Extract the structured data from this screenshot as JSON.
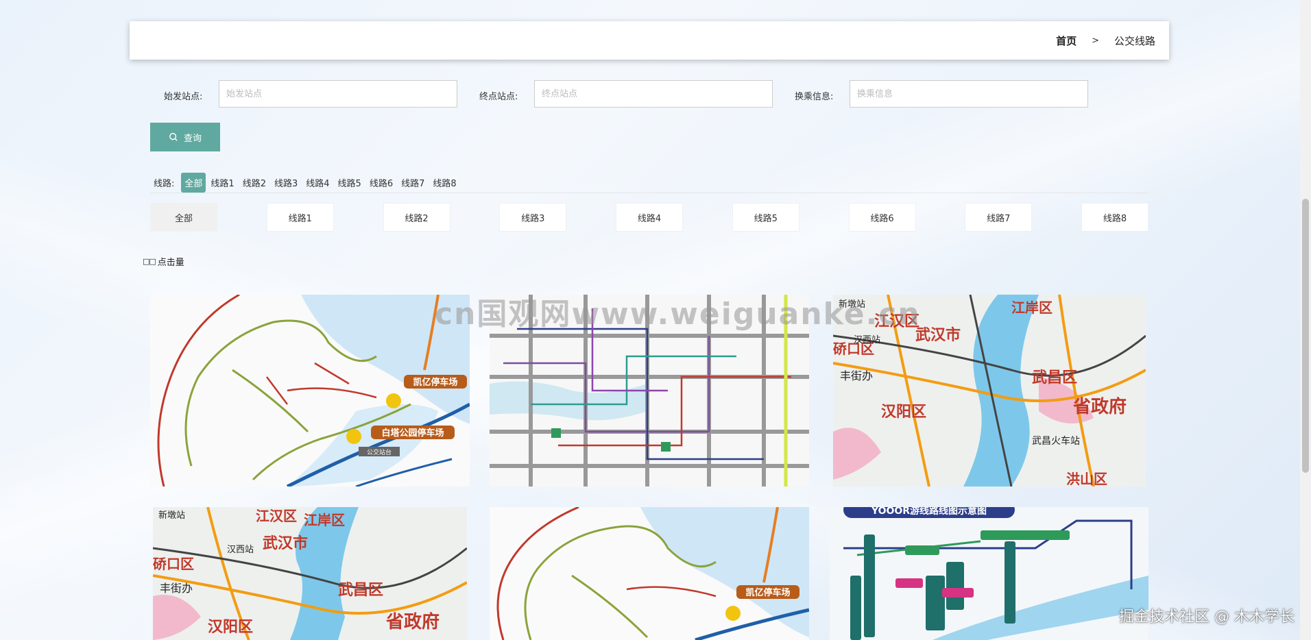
{
  "breadcrumb": {
    "home": "首页",
    "separator": ">",
    "current": "公交线路"
  },
  "search": {
    "start_label": "始发站点:",
    "start_placeholder": "始发站点",
    "end_label": "终点站点:",
    "end_placeholder": "终点站点",
    "transfer_label": "换乘信息:",
    "transfer_placeholder": "换乘信息",
    "query_button": "查询"
  },
  "filter": {
    "label": "线路:",
    "items": [
      "全部",
      "线路1",
      "线路2",
      "线路3",
      "线路4",
      "线路5",
      "线路6",
      "线路7",
      "线路8"
    ],
    "active": "全部"
  },
  "tabs": [
    "全部",
    "线路1",
    "线路2",
    "线路3",
    "线路4",
    "线路5",
    "线路6",
    "线路7",
    "线路8"
  ],
  "sort_label": "点击量",
  "map_labels": {
    "kaiyi": "凯亿停车场",
    "baita": "白塔公园停车场",
    "bus_stop": "公交站台",
    "jianghan": "江汉区",
    "jiangan": "江岸区",
    "wuhan": "武汉市",
    "wuchang": "武昌区",
    "hanyang": "汉阳区",
    "qiaokou": "硚口区",
    "provincial_gov": "省政府",
    "hongshan": "洪山区",
    "hanxi": "汉西站",
    "wuchang_station": "武昌火车站",
    "fengtang": "丰街办",
    "xinqiao": "新墩站",
    "route_title": "YOOOR游线路线图示意图"
  },
  "watermark": "cn国观网www.weiguanke.cn",
  "credit": "掘金技术社区 @ 木木学长",
  "colors": {
    "accent": "#5fa9a0"
  }
}
